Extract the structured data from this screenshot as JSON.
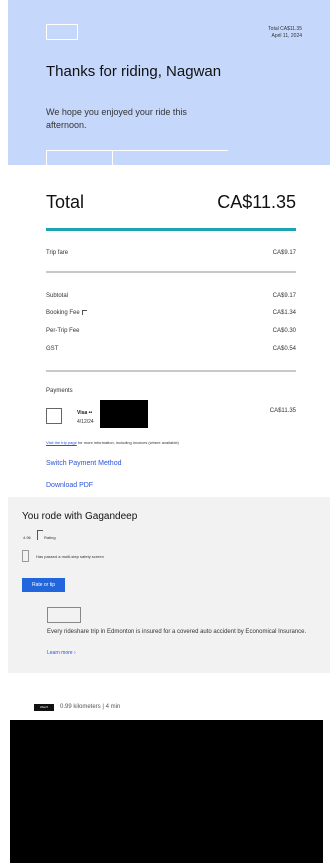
{
  "header": {
    "meta_line1": "Total CA$11.35",
    "meta_line2": "April 11, 2024",
    "title": "Thanks for riding, Nagwan",
    "subtitle": "We hope you enjoyed your ride this afternoon."
  },
  "summary": {
    "total_label": "Total",
    "total_value": "CA$11.35",
    "trip_fare_label": "Trip fare",
    "trip_fare_value": "CA$9.17",
    "rows": [
      {
        "label": "Subtotal",
        "value": "CA$9.17"
      },
      {
        "label": "Booking Fee",
        "value": "CA$1.34"
      },
      {
        "label": "Per-Trip Fee",
        "value": "CA$0.30"
      },
      {
        "label": "GST",
        "value": "CA$0.54"
      }
    ]
  },
  "payments": {
    "heading": "Payments",
    "card_label": "Visa ••",
    "card_date": "4/12/24",
    "amount": "CA$11.35",
    "note_link": "Visit the trip page",
    "note_text": " for more information, including invoices (where available)",
    "switch_label": "Switch Payment Method",
    "download_label": "Download PDF"
  },
  "driver": {
    "title": "You rode with Gagandeep",
    "rating": "4.96",
    "rating_label": "Rating",
    "safety_text": "Has passed a multi-step safety screen",
    "rate_button": "Rate or tip",
    "insurance_text": "Every rideshare trip in Edmonton is insured for a covered auto accident by Economical Insurance.",
    "learn_more": "Learn more ›"
  },
  "trip": {
    "badge": "UberX",
    "distance": "0.99 kilometers | 4 min"
  }
}
